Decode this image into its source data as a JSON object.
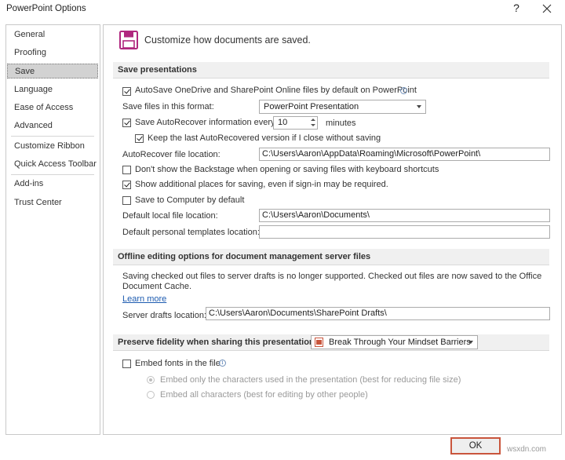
{
  "window": {
    "title": "PowerPoint Options",
    "help_label": "?"
  },
  "sidebar": {
    "items": [
      {
        "label": "General"
      },
      {
        "label": "Proofing"
      },
      {
        "label": "Save"
      },
      {
        "label": "Language"
      },
      {
        "label": "Ease of Access"
      },
      {
        "label": "Advanced"
      },
      {
        "label": "Customize Ribbon"
      },
      {
        "label": "Quick Access Toolbar"
      },
      {
        "label": "Add-ins"
      },
      {
        "label": "Trust Center"
      }
    ],
    "selected": "Save"
  },
  "header": {
    "text": "Customize how documents are saved."
  },
  "save_presentations": {
    "title": "Save presentations",
    "autosave_label": "AutoSave OneDrive and SharePoint Online files by default on PowerPoint",
    "format_label": "Save files in this format:",
    "format_value": "PowerPoint Presentation",
    "autorecover_label": "Save AutoRecover information every",
    "autorecover_minutes": "10",
    "minutes_label": "minutes",
    "keep_last_label": "Keep the last AutoRecovered version if I close without saving",
    "autorecover_location_label": "AutoRecover file location:",
    "autorecover_location_value": "C:\\Users\\Aaron\\AppData\\Roaming\\Microsoft\\PowerPoint\\",
    "dont_show_backstage_label": "Don't show the Backstage when opening or saving files with keyboard shortcuts",
    "show_additional_label": "Show additional places for saving, even if sign-in may be required.",
    "save_to_computer_label": "Save to Computer by default",
    "default_local_label": "Default local file location:",
    "default_local_value": "C:\\Users\\Aaron\\Documents\\",
    "default_templates_label": "Default personal templates location:",
    "default_templates_value": ""
  },
  "offline": {
    "title": "Offline editing options for document management server files",
    "message_line1": "Saving checked out files to server drafts is no longer supported. Checked out files are now saved to the Office",
    "message_line2": "Document Cache.",
    "learn_more": "Learn more",
    "server_drafts_label": "Server drafts location:",
    "server_drafts_value": "C:\\Users\\Aaron\\Documents\\SharePoint Drafts\\"
  },
  "fidelity": {
    "title": "Preserve fidelity when sharing this presentation:",
    "presentation_value": "Break Through Your Mindset Barriers",
    "embed_fonts_label": "Embed fonts in the file",
    "embed_only_label": "Embed only the characters used in the presentation (best for reducing file size)",
    "embed_all_label": "Embed all characters (best for editing by other people)"
  },
  "footer": {
    "ok_label": "OK",
    "watermark": "wsxdn.com"
  },
  "colors": {
    "accent_border": "#c9553c",
    "save_icon": "#b0287f",
    "link": "#1d5bb0"
  }
}
